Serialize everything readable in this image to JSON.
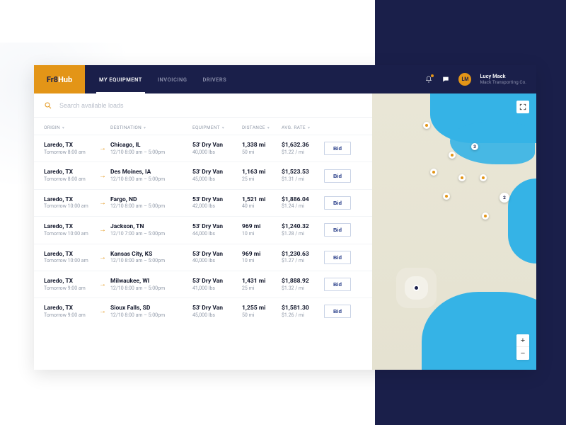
{
  "brand": {
    "left": "Fr8",
    "right": "Hub"
  },
  "nav": {
    "equipment": "MY EQUIPMENT",
    "invoicing": "INVOICING",
    "drivers": "DRIVERS"
  },
  "user": {
    "initials": "LM",
    "name": "Lucy Mack",
    "company": "Mack Transporting Co."
  },
  "search": {
    "placeholder": "Search available loads"
  },
  "columns": {
    "origin": "ORIGIN",
    "destination": "DESTINATION",
    "equipment": "EQUIPMENT",
    "distance": "DISTANCE",
    "rate": "AVG. RATE"
  },
  "action_label": "Bid",
  "map": {
    "cluster_a": "3",
    "cluster_b": "2"
  },
  "rows": [
    {
      "origin": "Laredo, TX",
      "otime": "Tomorrow 8:00 am",
      "dest": "Chicago, IL",
      "dtime": "12/10 8:00 am – 5:00pm",
      "equip": "53' Dry Van",
      "weight": "40,000 lbs",
      "dist": "1,338 mi",
      "dsub": "50 mi",
      "rate": "$1,632.36",
      "rsub": "$1.22 / mi"
    },
    {
      "origin": "Laredo, TX",
      "otime": "Tomorrow 8:00 am",
      "dest": "Des Moines, IA",
      "dtime": "12/10 8:00 am – 5:00pm",
      "equip": "53' Dry Van",
      "weight": "45,000 lbs",
      "dist": "1,163 mi",
      "dsub": "25 mi",
      "rate": "$1,523.53",
      "rsub": "$1.31 / mi"
    },
    {
      "origin": "Laredo, TX",
      "otime": "Tomorrow 10:00 am",
      "dest": "Fargo, ND",
      "dtime": "12/10 8:00 am – 5:00pm",
      "equip": "53' Dry Van",
      "weight": "42,000 lbs",
      "dist": "1,521 mi",
      "dsub": "40 mi",
      "rate": "$1,886.04",
      "rsub": "$1.24 / mi"
    },
    {
      "origin": "Laredo, TX",
      "otime": "Tomorrow 10:00 am",
      "dest": "Jackson, TN",
      "dtime": "12/10 7:00 am – 5:00pm",
      "equip": "53' Dry Van",
      "weight": "44,000 lbs",
      "dist": "969 mi",
      "dsub": "10 mi",
      "rate": "$1,240.32",
      "rsub": "$1.28 / mi"
    },
    {
      "origin": "Laredo, TX",
      "otime": "Tomorrow 10:00 am",
      "dest": "Kansas City, KS",
      "dtime": "12/10 8:00 am – 5:00pm",
      "equip": "53' Dry Van",
      "weight": "40,000 lbs",
      "dist": "969 mi",
      "dsub": "10 mi",
      "rate": "$1,230.63",
      "rsub": "$1.27 / mi"
    },
    {
      "origin": "Laredo, TX",
      "otime": "Tomorrow 9:00 am",
      "dest": "Milwaukee, WI",
      "dtime": "12/10 8:00 am – 5:00pm",
      "equip": "53' Dry Van",
      "weight": "41,000 lbs",
      "dist": "1,431 mi",
      "dsub": "25 mi",
      "rate": "$1,888.92",
      "rsub": "$1.32 / mi"
    },
    {
      "origin": "Laredo, TX",
      "otime": "Tomorrow 9:00 am",
      "dest": "Sioux Falls, SD",
      "dtime": "12/10 8:00 am – 5:00pm",
      "equip": "53' Dry Van",
      "weight": "45,000 lbs",
      "dist": "1,255 mi",
      "dsub": "50 mi",
      "rate": "$1,581.30",
      "rsub": "$1.26 / mi"
    }
  ]
}
